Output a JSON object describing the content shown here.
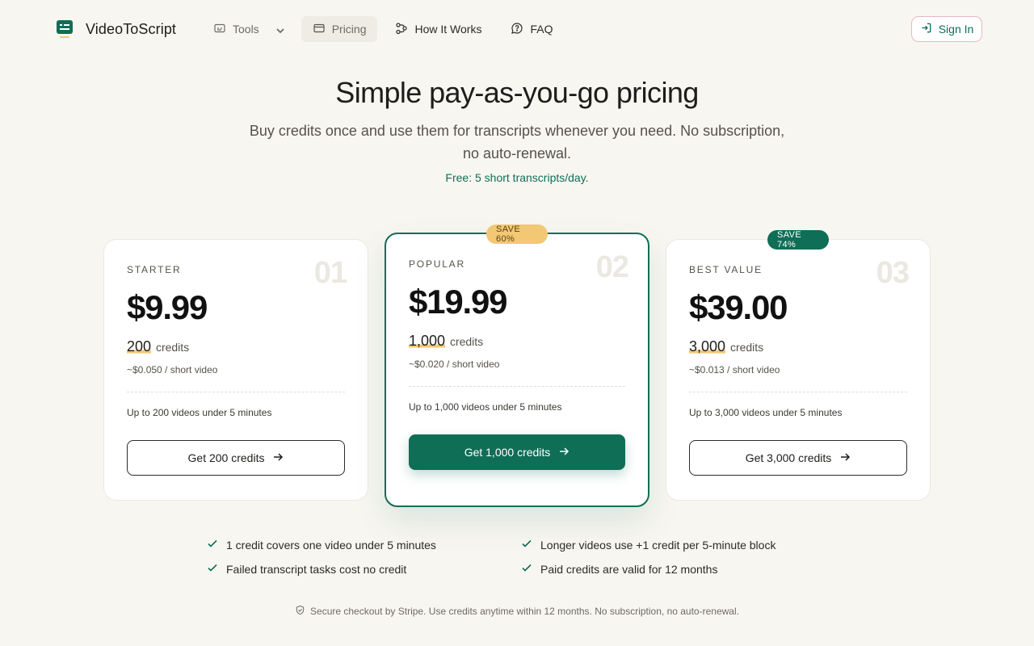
{
  "brand": {
    "name": "VideoToScript",
    "logo_icon": "subtitle-logo-icon"
  },
  "nav": {
    "items": [
      {
        "label": "Tools",
        "icon": "caption-icon",
        "has_dropdown": true
      },
      {
        "label": "Pricing",
        "icon": "card-icon",
        "active": true
      },
      {
        "label": "How It Works",
        "icon": "flow-icon"
      },
      {
        "label": "FAQ",
        "icon": "help-icon"
      }
    ],
    "signin_label": "Sign In"
  },
  "hero": {
    "title": "Simple pay-as-you-go pricing",
    "subtitle": "Buy credits once and use them for transcripts whenever you need. No subscription, no auto-renewal.",
    "free_note": "Free: 5 short transcripts/day."
  },
  "plans": [
    {
      "tier": "STARTER",
      "number": "01",
      "price": "$9.99",
      "credits": "200",
      "credits_unit": "credits",
      "per_video": "~$0.050 / short video",
      "limit": "Up to 200 videos under 5 minutes",
      "cta": "Get 200 credits",
      "badge": ""
    },
    {
      "tier": "POPULAR",
      "number": "02",
      "price": "$19.99",
      "credits": "1,000",
      "credits_unit": "credits",
      "per_video": "~$0.020 / short video",
      "limit": "Up to 1,000 videos under 5 minutes",
      "cta": "Get 1,000 credits",
      "badge": "SAVE 60%"
    },
    {
      "tier": "BEST VALUE",
      "number": "03",
      "price": "$39.00",
      "credits": "3,000",
      "credits_unit": "credits",
      "per_video": "~$0.013 / short video",
      "limit": "Up to 3,000 videos under 5 minutes",
      "cta": "Get 3,000 credits",
      "badge": "SAVE 74%"
    }
  ],
  "features": [
    "1 credit covers one video under 5 minutes",
    "Longer videos use +1 credit per 5-minute block",
    "Failed transcript tasks cost no credit",
    "Paid credits are valid for 12 months"
  ],
  "footer_note": "Secure checkout by Stripe. Use credits anytime within 12 months. No subscription, no auto-renewal.",
  "colors": {
    "accent": "#0f6e56",
    "highlight": "#f3c874",
    "background": "#f8f6f1"
  }
}
